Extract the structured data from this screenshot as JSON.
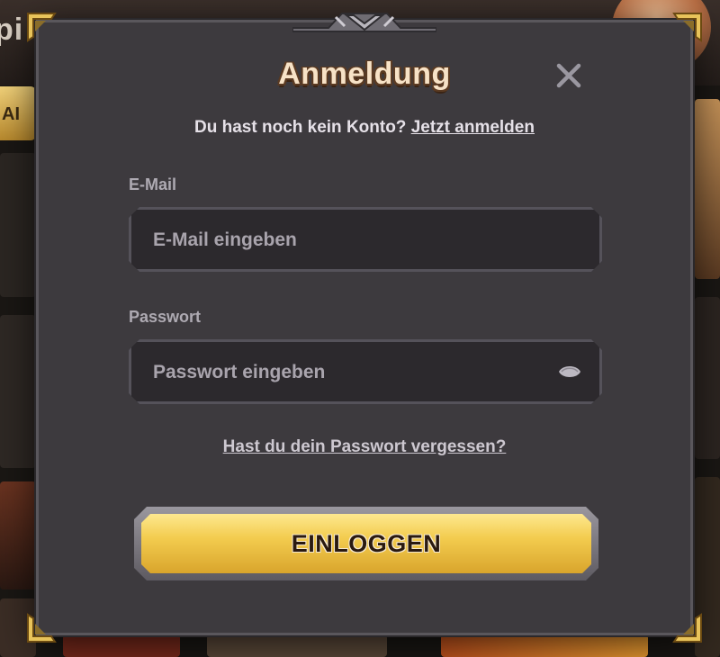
{
  "background": {
    "title_fragment": "pi",
    "tag_fragment": "AI"
  },
  "dialog": {
    "title": "Anmeldung",
    "close_icon": "close-icon",
    "signup_prompt": "Du hast noch kein Konto?",
    "signup_link": "Jetzt anmelden",
    "email": {
      "label": "E-Mail",
      "value": "",
      "placeholder": "E-Mail eingeben"
    },
    "password": {
      "label": "Passwort",
      "value": "",
      "placeholder": "Passwort eingeben",
      "toggle_icon": "eye-icon"
    },
    "forgot_password": "Hast du dein Passwort vergessen?",
    "login_button": "EINLOGGEN"
  },
  "colors": {
    "dialog_background": "#3d3a3e",
    "title_text": "#f7e2c6",
    "button_gold": "#f3cc4f",
    "field_background": "#2c292d"
  }
}
